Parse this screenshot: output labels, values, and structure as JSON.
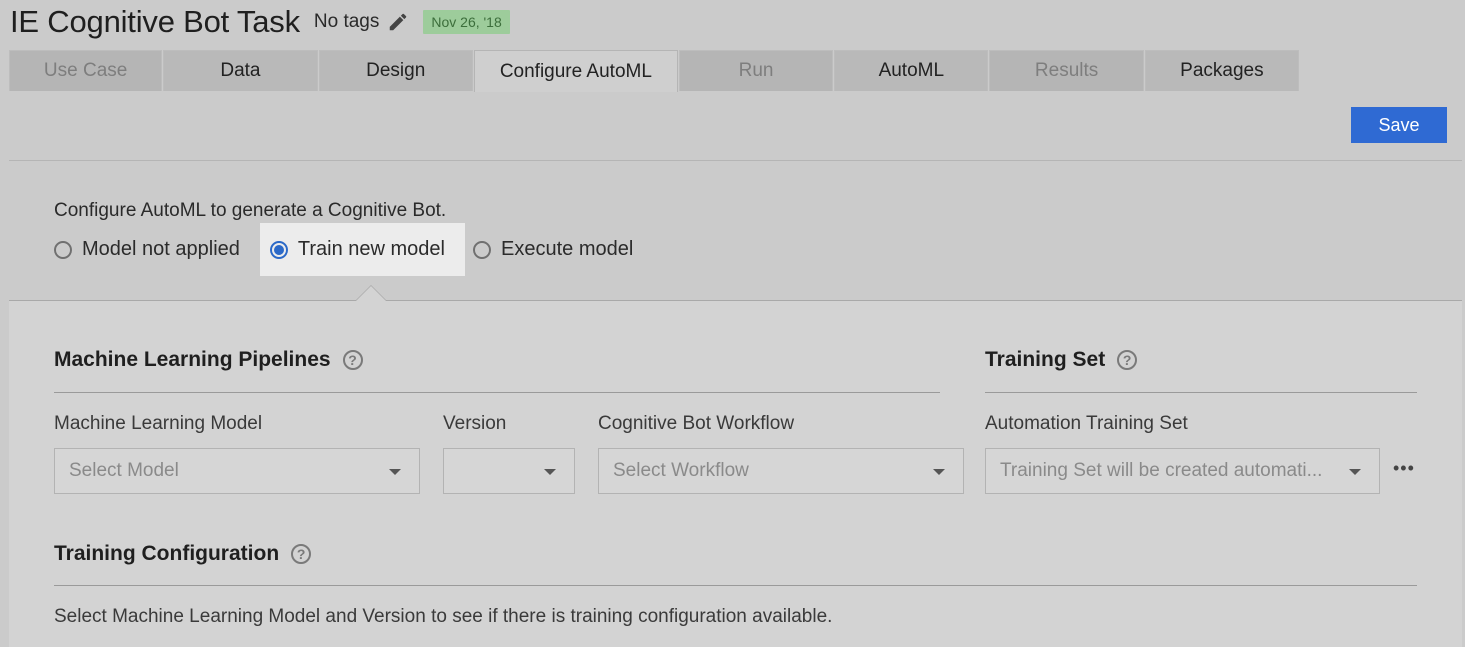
{
  "header": {
    "title": "IE Cognitive Bot Task",
    "tags": "No tags",
    "date": "Nov 26, '18"
  },
  "tabs": [
    {
      "label": "Use Case",
      "state": "disabled"
    },
    {
      "label": "Data",
      "state": "normal"
    },
    {
      "label": "Design",
      "state": "normal"
    },
    {
      "label": "Configure AutoML",
      "state": "active"
    },
    {
      "label": "Run",
      "state": "disabled"
    },
    {
      "label": "AutoML",
      "state": "normal"
    },
    {
      "label": "Results",
      "state": "disabled"
    },
    {
      "label": "Packages",
      "state": "normal"
    }
  ],
  "toolbar": {
    "save_label": "Save"
  },
  "config": {
    "description": "Configure AutoML to generate a Cognitive Bot.",
    "options": [
      {
        "label": "Model not applied",
        "selected": false
      },
      {
        "label": "Train new model",
        "selected": true
      },
      {
        "label": "Execute model",
        "selected": false
      }
    ]
  },
  "pipelines": {
    "title": "Machine Learning Pipelines",
    "model_label": "Machine Learning Model",
    "model_placeholder": "Select Model",
    "version_label": "Version",
    "version_value": "",
    "workflow_label": "Cognitive Bot Workflow",
    "workflow_placeholder": "Select Workflow"
  },
  "training_set": {
    "title": "Training Set",
    "label": "Automation Training Set",
    "value": "Training Set will be created automati..."
  },
  "training_config": {
    "title": "Training Configuration",
    "hint": "Select Machine Learning Model and Version to see if there is training configuration available."
  },
  "colors": {
    "accent": "#2f6ad3",
    "badge": "#9dcc9b"
  }
}
